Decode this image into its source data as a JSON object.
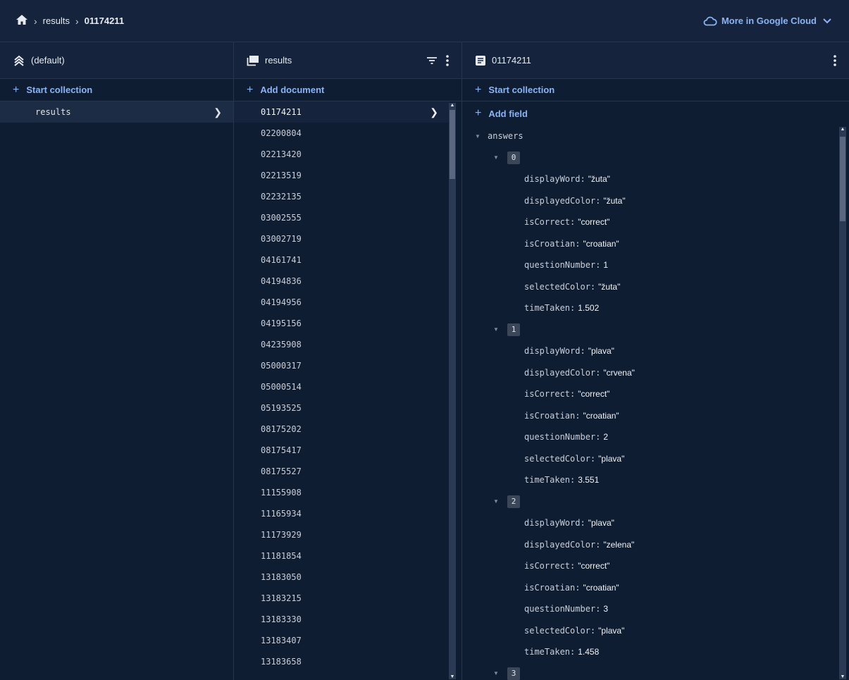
{
  "breadcrumb": {
    "items": [
      "results",
      "01174211"
    ]
  },
  "header": {
    "more_label": "More in Google Cloud"
  },
  "col1": {
    "title": "(default)",
    "action": "Start collection",
    "items": [
      {
        "label": "results"
      }
    ]
  },
  "col2": {
    "title": "results",
    "action": "Add document",
    "items": [
      "01174211",
      "02200804",
      "02213420",
      "02213519",
      "02232135",
      "03002555",
      "03002719",
      "04161741",
      "04194836",
      "04194956",
      "04195156",
      "04235908",
      "05000317",
      "05000514",
      "05193525",
      "08175202",
      "08175417",
      "08175527",
      "11155908",
      "11165934",
      "11173929",
      "11181854",
      "13183050",
      "13183215",
      "13183330",
      "13183407",
      "13183658"
    ]
  },
  "col3": {
    "title": "01174211",
    "action": "Start collection",
    "add_field": "Add field",
    "field_name": "answers",
    "answers": [
      {
        "index": "0",
        "fields": [
          {
            "key": "displayWord:",
            "value": "\"žuta\""
          },
          {
            "key": "displayedColor:",
            "value": "\"žuta\""
          },
          {
            "key": "isCorrect:",
            "value": "\"correct\""
          },
          {
            "key": "isCroatian:",
            "value": "\"croatian\""
          },
          {
            "key": "questionNumber:",
            "value": "1"
          },
          {
            "key": "selectedColor:",
            "value": "\"žuta\""
          },
          {
            "key": "timeTaken:",
            "value": "1.502"
          }
        ]
      },
      {
        "index": "1",
        "fields": [
          {
            "key": "displayWord:",
            "value": "\"plava\""
          },
          {
            "key": "displayedColor:",
            "value": "\"crvena\""
          },
          {
            "key": "isCorrect:",
            "value": "\"correct\""
          },
          {
            "key": "isCroatian:",
            "value": "\"croatian\""
          },
          {
            "key": "questionNumber:",
            "value": "2"
          },
          {
            "key": "selectedColor:",
            "value": "\"plava\""
          },
          {
            "key": "timeTaken:",
            "value": "3.551"
          }
        ]
      },
      {
        "index": "2",
        "fields": [
          {
            "key": "displayWord:",
            "value": "\"plava\""
          },
          {
            "key": "displayedColor:",
            "value": "\"zelena\""
          },
          {
            "key": "isCorrect:",
            "value": "\"correct\""
          },
          {
            "key": "isCroatian:",
            "value": "\"croatian\""
          },
          {
            "key": "questionNumber:",
            "value": "3"
          },
          {
            "key": "selectedColor:",
            "value": "\"plava\""
          },
          {
            "key": "timeTaken:",
            "value": "1.458"
          }
        ]
      },
      {
        "index": "3",
        "fields": []
      }
    ]
  },
  "colors": {
    "accent": "#8ab4f8",
    "background": "#0f1d33",
    "header": "#15243c",
    "selected": "#1d2c45"
  }
}
